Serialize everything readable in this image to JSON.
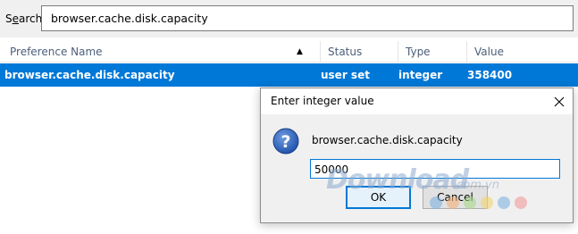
{
  "search": {
    "label_prefix": "S",
    "label_underlined": "e",
    "label_suffix": "arch:",
    "value": "browser.cache.disk.capacity"
  },
  "columns": {
    "name": "Preference Name",
    "status": "Status",
    "type": "Type",
    "value": "Value"
  },
  "rows": [
    {
      "name": "browser.cache.disk.capacity",
      "status": "user set",
      "type": "integer",
      "value": "358400"
    }
  ],
  "dialog": {
    "title": "Enter integer value",
    "prompt": "browser.cache.disk.capacity",
    "input_value": "50000",
    "ok_label": "OK",
    "cancel_label": "Cancel",
    "icon": "question-icon",
    "close_icon": "close-icon"
  },
  "watermark": {
    "text": "Download",
    "suffix": ".com.vn",
    "dot_colors": [
      "#7fb3e0",
      "#f2b07a",
      "#a6d98a",
      "#f3d36e",
      "#7fb3e0",
      "#f29a9a"
    ]
  },
  "colors": {
    "selection": "#0078d7",
    "header_text": "#4c607a",
    "dialog_bg": "#f0f0f0"
  }
}
